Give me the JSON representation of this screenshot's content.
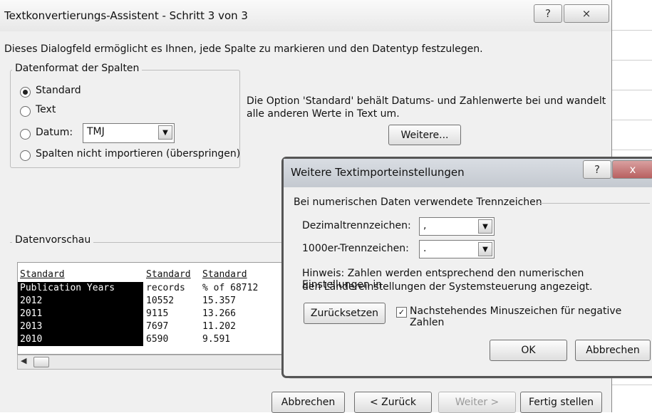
{
  "main_dialog": {
    "title": "Textkonvertierungs-Assistent - Schritt 3 von 3",
    "help_icon": "?",
    "close_icon": "⨯",
    "description": "Dieses Dialogfeld ermöglicht es Ihnen, jede Spalte zu markieren und den Datentyp festzulegen.",
    "column_format": {
      "legend": "Datenformat der Spalten",
      "options": [
        {
          "label": "Standard",
          "selected": true
        },
        {
          "label": "Text",
          "selected": false
        },
        {
          "label": "Datum:",
          "selected": false
        },
        {
          "label": "Spalten nicht importieren (überspringen)",
          "selected": false
        }
      ],
      "date_format_value": "TMJ"
    },
    "info_text_line1": "Die Option 'Standard' behält Datums- und Zahlenwerte bei und wandelt",
    "info_text_line2": "alle anderen Werte in Text um.",
    "more_button": "Weitere...",
    "preview": {
      "legend": "Datenvorschau",
      "headers": [
        "Standard",
        "Standard",
        "Standard"
      ],
      "rows": [
        [
          "Publication Years",
          "records",
          "% of 68712"
        ],
        [
          "2012",
          "10552",
          "15.357"
        ],
        [
          "2011",
          "9115",
          "13.266"
        ],
        [
          "2013",
          "7697",
          "11.202"
        ],
        [
          "2010",
          "6590",
          "9.591"
        ]
      ]
    },
    "buttons": {
      "cancel": "Abbrechen",
      "back": "< Zurück",
      "next": "Weiter >",
      "finish": "Fertig stellen"
    }
  },
  "sub_dialog": {
    "title": "Weitere Textimporteinstellungen",
    "help_icon": "?",
    "close_icon": "x",
    "section_label": "Bei numerischen Daten verwendete Trennzeichen",
    "decimal_label": "Dezimaltrennzeichen:",
    "decimal_value": ",",
    "thousands_label": "1000er-Trennzeichen:",
    "thousands_value": ".",
    "hint_line1": "Hinweis: Zahlen werden entsprechend den numerischen Einstellungen in",
    "hint_line2": "den Ländereinstellungen der Systemsteuerung angezeigt.",
    "reset_button": "Zurücksetzen",
    "trailing_minus_label": "Nachstehendes Minuszeichen für negative Zahlen",
    "trailing_minus_checked": true,
    "ok_button": "OK",
    "cancel_button": "Abbrechen"
  }
}
